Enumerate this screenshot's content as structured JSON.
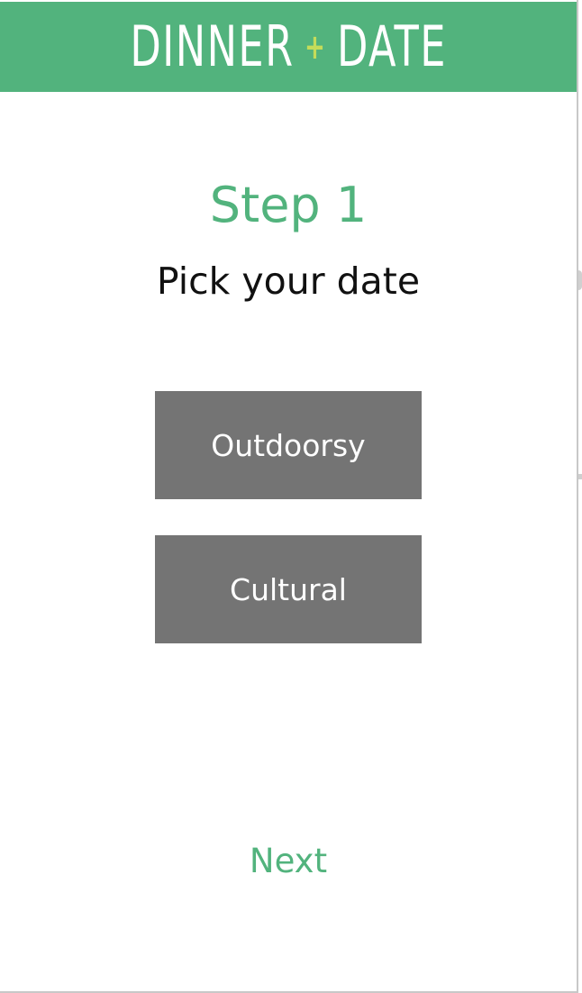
{
  "colors": {
    "brand": "#52b37d",
    "accent": "#c4dc5a",
    "button_bg": "#747474"
  },
  "header": {
    "logo_left": "DINNER",
    "logo_plus": "+",
    "logo_right": "DATE"
  },
  "step": {
    "title": "Step 1",
    "subtitle": "Pick your date"
  },
  "options": [
    {
      "label": "Outdoorsy"
    },
    {
      "label": "Cultural"
    }
  ],
  "footer": {
    "next_label": "Next"
  }
}
